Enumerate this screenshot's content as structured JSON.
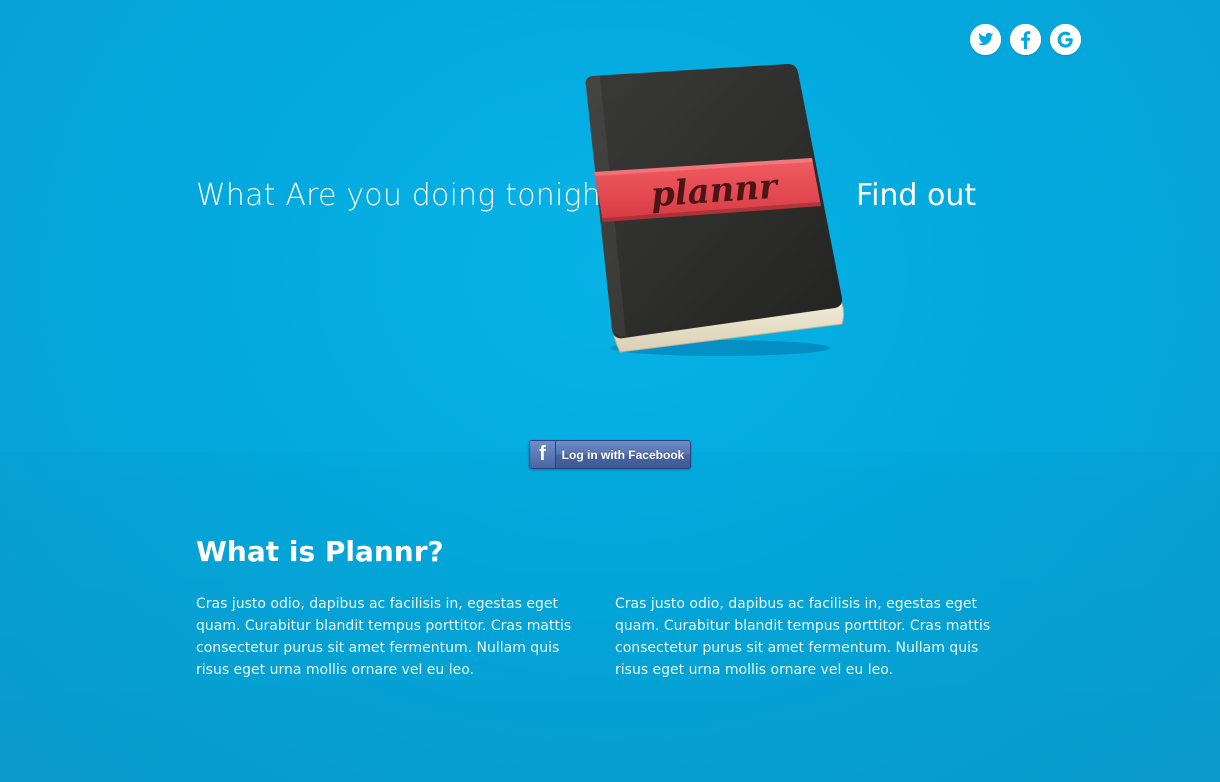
{
  "social": {
    "twitter_icon": "twitter-icon",
    "facebook_icon": "facebook-icon",
    "google_icon": "google-icon",
    "icon_color": "#03a9de"
  },
  "hero": {
    "tagline": "What Are you doing tonight?",
    "cta": "Find out",
    "book_label": "plannr"
  },
  "login": {
    "fb_glyph": "f",
    "label": "Log in with Facebook"
  },
  "about": {
    "title": "What is Plannr?",
    "columns": [
      "Cras justo odio, dapibus ac facilisis in, egestas eget quam. Curabitur blandit tempus porttitor. Cras mattis consectetur purus sit amet fermentum. Nullam quis risus eget urna mollis ornare vel eu leo.",
      "Cras justo odio, dapibus ac facilisis in, egestas eget quam. Curabitur blandit tempus porttitor. Cras mattis consectetur purus sit amet fermentum. Nullam quis risus eget urna mollis ornare vel eu leo."
    ]
  },
  "colors": {
    "background": "#03a9de",
    "book_cover": "#2b2b2b",
    "band": "#e8474f",
    "facebook": "#3e5a95"
  }
}
